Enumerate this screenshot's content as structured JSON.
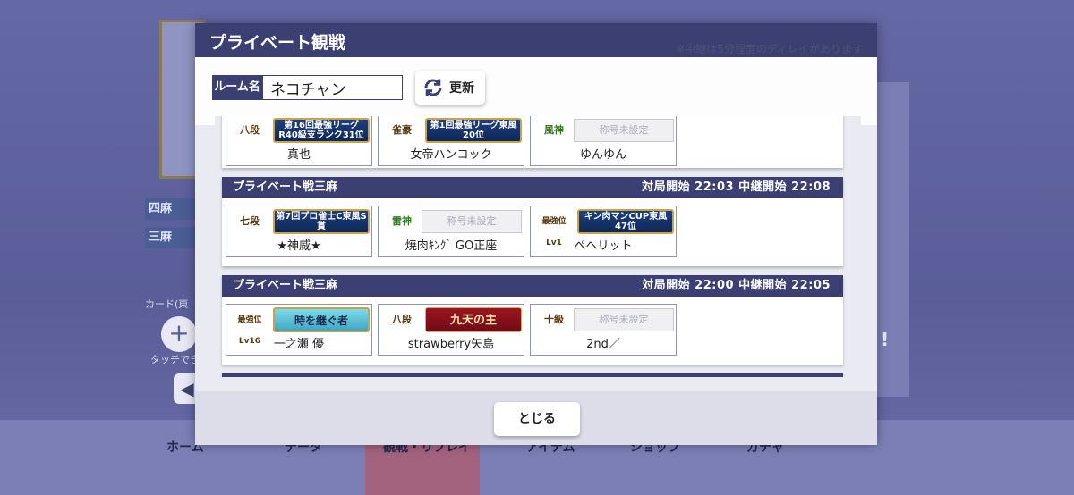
{
  "background": {
    "nav_items": [
      "ホーム",
      "データ",
      "観戦・リプレイ",
      "アイテム",
      "ショップ",
      "ガチャ"
    ],
    "side_tabs": [
      "四麻",
      "三麻"
    ],
    "card_label": "カード(東",
    "touch_label": "タッチでき",
    "right_mark": "!"
  },
  "modal": {
    "title": "プライベート観戦",
    "delay_note": "※中継は5分程度のディレイがあります",
    "room_label": "ルーム名",
    "room_value": "ネコチャン",
    "refresh_label": "更新",
    "close_label": "とじる"
  },
  "matches": [
    {
      "type": "",
      "times": "",
      "players": [
        {
          "rank": "八段",
          "title": "第16回最強リーグR40級支ランク31位",
          "name": "真也"
        },
        {
          "rank": "雀豪",
          "title": "第1回最強リーグ東風20位",
          "name": "女帝ハンコック"
        },
        {
          "rank": "風神",
          "title": "称号未設定",
          "name": "ゆんゆん"
        }
      ]
    },
    {
      "type": "プライベート戦三麻",
      "times": "対局開始 22:03 中継開始 22:08",
      "players": [
        {
          "rank": "七段",
          "title": "第7回プロ雀士C東風S賞",
          "name": "★神威★"
        },
        {
          "rank": "雷神",
          "title": "称号未設定",
          "name": "焼肉ｷﾝｸﾞ GO正座"
        },
        {
          "rank": "最強位Lv1",
          "title": "キン肉マンCUP東風47位",
          "name": "ぺへリット"
        }
      ]
    },
    {
      "type": "プライベート戦三麻",
      "times": "対局開始 22:00 中継開始 22:05",
      "players": [
        {
          "rank": "最強位Lv16",
          "title": "時を継ぐ者",
          "name": "一之瀬 優"
        },
        {
          "rank": "八段",
          "title": "九天の主",
          "name": "strawberry矢島"
        },
        {
          "rank": "十級",
          "title": "称号未設定",
          "name": "2nd／"
        }
      ]
    }
  ],
  "colors": {
    "header_navy": "#3b3f72",
    "modal_bg": "#e9eaf2",
    "plate_blue": "#1d3f7e",
    "plate_red": "#9d1420",
    "plate_gold": "#c9a349"
  }
}
